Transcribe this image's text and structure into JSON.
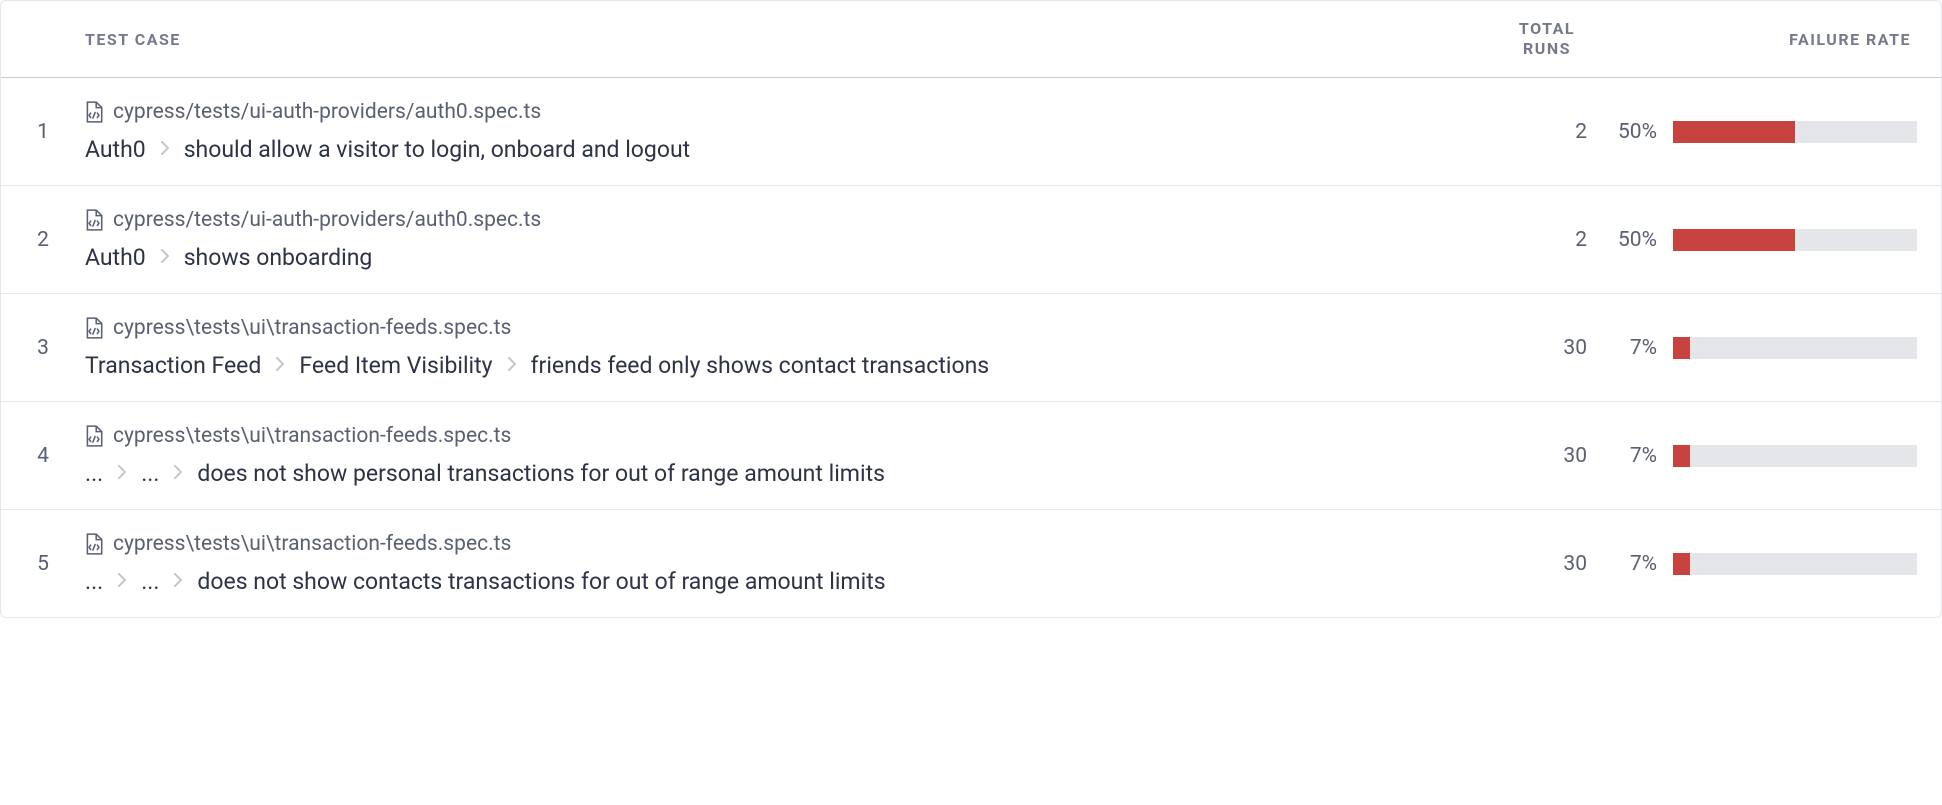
{
  "columns": {
    "testcase": "TEST CASE",
    "runs_line1": "TOTAL",
    "runs_line2": "RUNS",
    "failure": "FAILURE RATE"
  },
  "rows": [
    {
      "index": "1",
      "file": "cypress/tests/ui-auth-providers/auth0.spec.ts",
      "crumbs": [
        "Auth0",
        "should allow a visitor to login, onboard and logout"
      ],
      "runs": "2",
      "failure_pct": "50%",
      "failure_width": "50%"
    },
    {
      "index": "2",
      "file": "cypress/tests/ui-auth-providers/auth0.spec.ts",
      "crumbs": [
        "Auth0",
        "shows onboarding"
      ],
      "runs": "2",
      "failure_pct": "50%",
      "failure_width": "50%"
    },
    {
      "index": "3",
      "file": "cypress\\tests\\ui\\transaction-feeds.spec.ts",
      "crumbs": [
        "Transaction Feed",
        "Feed Item Visibility",
        "friends feed only shows contact transactions"
      ],
      "runs": "30",
      "failure_pct": "7%",
      "failure_width": "7%"
    },
    {
      "index": "4",
      "file": "cypress\\tests\\ui\\transaction-feeds.spec.ts",
      "crumbs": [
        "...",
        "...",
        "does not show personal transactions for out of range amount limits"
      ],
      "runs": "30",
      "failure_pct": "7%",
      "failure_width": "7%"
    },
    {
      "index": "5",
      "file": "cypress\\tests\\ui\\transaction-feeds.spec.ts",
      "crumbs": [
        "...",
        "...",
        "does not show contacts transactions for out of range amount limits"
      ],
      "runs": "30",
      "failure_pct": "7%",
      "failure_width": "7%"
    }
  ]
}
